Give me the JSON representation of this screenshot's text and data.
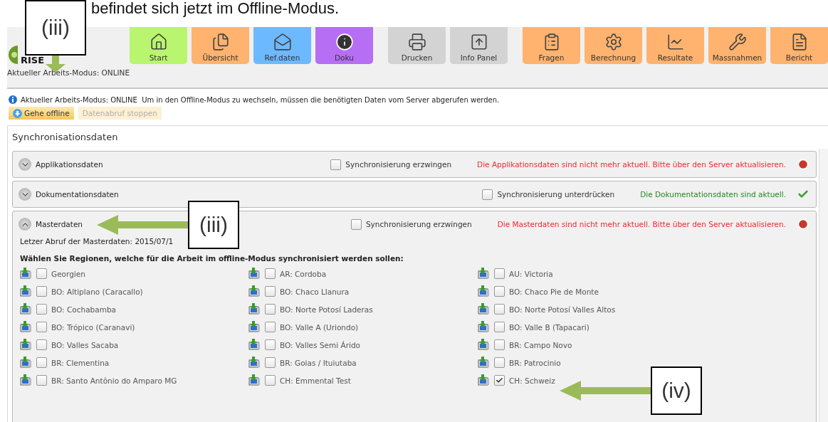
{
  "document_text": "befindet sich jetzt im Offline-Modus.",
  "app": {
    "logo": "RISE",
    "mode_status": "Aktueller Arbeits-Modus: ONLINE",
    "toolbar": [
      {
        "tiles": [
          {
            "label": "Start",
            "color": "#b9f56e",
            "kind": "house"
          },
          {
            "label": "Übersicht",
            "color": "#ffb36e",
            "kind": "documents"
          },
          {
            "label": "Ref.daten",
            "color": "#6db9ff",
            "kind": "envelope"
          },
          {
            "label": "Doku",
            "color": "#b66ef5",
            "kind": "info"
          }
        ]
      },
      {
        "tiles": [
          {
            "label": "Drucken",
            "color": "#d3d3d3",
            "kind": "printer"
          },
          {
            "label": "Info Panel",
            "color": "#d3d3d3",
            "kind": "upload"
          }
        ]
      },
      {
        "tiles": [
          {
            "label": "Fragen",
            "color": "#ffb36e",
            "kind": "list"
          },
          {
            "label": "Berechnung",
            "color": "#ffb36e",
            "kind": "gear"
          },
          {
            "label": "Resultate",
            "color": "#ffb36e",
            "kind": "chart"
          },
          {
            "label": "Massnahmen",
            "color": "#ffb36e",
            "kind": "wrench"
          },
          {
            "label": "Bericht",
            "color": "#ffb36e",
            "kind": "document"
          }
        ]
      }
    ],
    "info": "Aktueller Arbeits-Modus: ONLINE  Um in den Offline-Modus zu wechseln, müssen die benötigten Daten vom Server abgerufen werden.",
    "actions": [
      {
        "label": "Gehe offline",
        "disabled": false
      },
      {
        "label": "Datenabruf stoppen",
        "disabled": true
      }
    ],
    "panel": {
      "title": "Synchronisationsdaten",
      "sections": [
        {
          "title": "Applikationsdaten",
          "expanded": false,
          "option": {
            "label": "Synchronisierung erzwingen",
            "checked": false
          },
          "status": {
            "kind": "error",
            "text": "Die Applikationsdaten sind nicht mehr aktuell. Bitte über den Server aktualisieren."
          }
        },
        {
          "title": "Dokumentationsdaten",
          "expanded": false,
          "option": {
            "label": "Synchronisierung unterdrücken",
            "checked": false
          },
          "status": {
            "kind": "ok",
            "text": "Die Dokumentationsdaten sind aktuell."
          }
        },
        {
          "title": "Masterdaten",
          "expanded": true,
          "option": {
            "label": "Synchronisierung erzwingen",
            "checked": false
          },
          "status": {
            "kind": "error",
            "text": "Die Masterdaten sind nicht mehr aktuell. Bitte über den Server aktualisieren."
          },
          "last_fetch": "Letzer Abruf der Masterdaten:  2015/07/1",
          "prompt": "Wählen Sie Regionen, welche für die Arbeit im offline-Modus synchronisiert werden sollen:",
          "regions": [
            {
              "label": "Georgien",
              "checked": false
            },
            {
              "label": "AR: Cordoba",
              "checked": false
            },
            {
              "label": "AU: Victoria",
              "checked": false
            },
            {
              "label": "BO: Altiplano (Caracallo)",
              "checked": false
            },
            {
              "label": "BO: Chaco Llanura",
              "checked": false
            },
            {
              "label": "BO: Chaco Pie de Monte",
              "checked": false
            },
            {
              "label": "BO: Cochabamba",
              "checked": false
            },
            {
              "label": "BO: Norte Potosí Laderas",
              "checked": false
            },
            {
              "label": "BO: Norte Potosí Valles Altos",
              "checked": false
            },
            {
              "label": "BO: Trópico (Caranavi)",
              "checked": false
            },
            {
              "label": "BO: Valle A (Uriondo)",
              "checked": false
            },
            {
              "label": "BO: Valle B (Tapacari)",
              "checked": false
            },
            {
              "label": "BO: Valles Sacaba",
              "checked": false
            },
            {
              "label": "BO: Valles Semi Árido",
              "checked": false
            },
            {
              "label": "BR: Campo Novo",
              "checked": false
            },
            {
              "label": "BR: Clementina",
              "checked": false
            },
            {
              "label": "BR: Goias / Ituiutaba",
              "checked": false
            },
            {
              "label": "BR: Patrocinio",
              "checked": false
            },
            {
              "label": "BR: Santo Antônio do Amparo MG",
              "checked": false
            },
            {
              "label": "CH: Emmental Test",
              "checked": false
            },
            {
              "label": "CH: Schweiz",
              "checked": true
            }
          ]
        }
      ]
    }
  },
  "annotations": [
    {
      "label": "(iii)",
      "kind": "down"
    },
    {
      "label": "(iii)",
      "kind": "left"
    },
    {
      "label": "(iv)",
      "kind": "left"
    }
  ]
}
